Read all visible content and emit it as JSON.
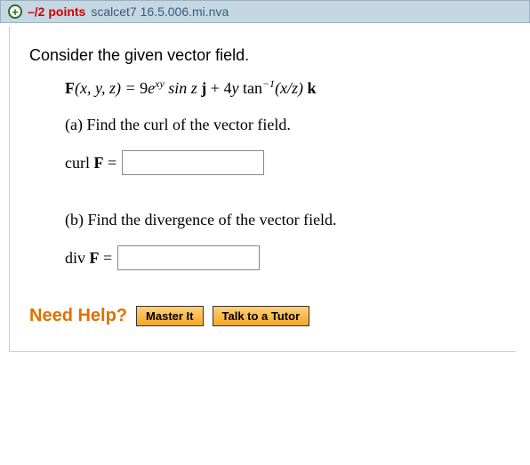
{
  "header": {
    "expand_glyph": "+",
    "points": "–/2 points",
    "question_id": "scalcet7 16.5.006.mi.nva"
  },
  "prompt": "Consider the given vector field.",
  "formula": {
    "lhs_fn": "F",
    "lhs_args": "(x, y, z) = ",
    "term1_coef": "9",
    "term1_e": "e",
    "term1_exp": "xy",
    "term1_rest": " sin z ",
    "term1_vec": "j",
    "plus": " + ",
    "term2_coef": "4",
    "term2_y": "y",
    "term2_tan": " tan",
    "term2_sup": "−1",
    "term2_arg": "(x/z) ",
    "term2_vec": "k"
  },
  "parts": {
    "a": {
      "text": "(a) Find the curl of the vector field.",
      "label_pre": "curl ",
      "label_bold": "F",
      "label_post": " =",
      "value": ""
    },
    "b": {
      "text": "(b) Find the divergence of the vector field.",
      "label_pre": "div ",
      "label_bold": "F",
      "label_post": " =",
      "value": ""
    }
  },
  "help": {
    "title": "Need Help?",
    "master_it": "Master It",
    "talk_tutor": "Talk to a Tutor"
  }
}
